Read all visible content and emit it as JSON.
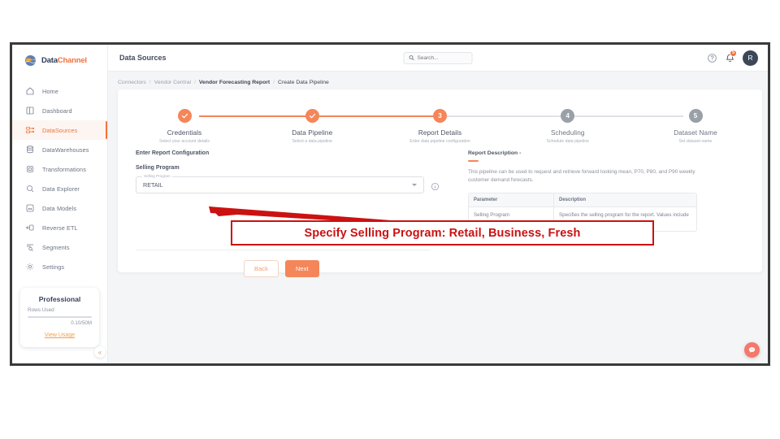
{
  "brand": {
    "part1": "Data",
    "part2": "Channel",
    "logo_icon": "globe-logo-icon"
  },
  "sidebar": {
    "items": [
      {
        "label": "Home",
        "icon": "home-icon",
        "active": false
      },
      {
        "label": "Dashboard",
        "icon": "dashboard-icon",
        "active": false
      },
      {
        "label": "DataSources",
        "icon": "datasources-icon",
        "active": true
      },
      {
        "label": "DataWarehouses",
        "icon": "database-icon",
        "active": false
      },
      {
        "label": "Transformations",
        "icon": "transformations-icon",
        "active": false
      },
      {
        "label": "Data Explorer",
        "icon": "explorer-icon",
        "active": false
      },
      {
        "label": "Data Models",
        "icon": "models-icon",
        "active": false
      },
      {
        "label": "Reverse ETL",
        "icon": "reverse-etl-icon",
        "active": false
      },
      {
        "label": "Segments",
        "icon": "segments-icon",
        "active": false
      },
      {
        "label": "Settings",
        "icon": "gear-icon",
        "active": false
      }
    ],
    "plan": {
      "tier": "Professional",
      "rows_label": "Rows Used",
      "usage": "0.10/50M",
      "view_usage": "View Usage",
      "progress_pct": 1
    },
    "collapse_glyph": "«"
  },
  "header": {
    "title": "Data Sources",
    "search": {
      "placeholder": "Search...",
      "value": ""
    },
    "help_icon": "help-circle-icon",
    "bell_icon": "bell-icon",
    "bell_badge": "5",
    "avatar_initial": "R"
  },
  "breadcrumb": [
    {
      "label": "Connectors",
      "style": "muted"
    },
    {
      "label": "Vendor Central",
      "style": "muted"
    },
    {
      "label": "Vendor Forecasting Report",
      "style": "strong"
    },
    {
      "label": "Create Data Pipeline",
      "style": "last"
    }
  ],
  "stepper": {
    "steps": [
      {
        "num": "1",
        "title": "Credentials",
        "sub": "Select your account details",
        "state": "done"
      },
      {
        "num": "2",
        "title": "Data Pipeline",
        "sub": "Select a data pipeline",
        "state": "done"
      },
      {
        "num": "3",
        "title": "Report Details",
        "sub": "Enter data pipeline configuration",
        "state": "active"
      },
      {
        "num": "4",
        "title": "Scheduling",
        "sub": "Schedule data pipeline",
        "state": "todo"
      },
      {
        "num": "5",
        "title": "Dataset Name",
        "sub": "Set dataset name",
        "state": "todo"
      }
    ]
  },
  "form": {
    "section_title": "Enter Report Configuration",
    "field_label": "Selling Program",
    "select": {
      "floating_label": "Selling Program",
      "value": "RETAIL",
      "options": [
        "RETAIL",
        "BUSINESS",
        "FRESH"
      ],
      "caret_icon": "chevron-down-icon",
      "info_icon": "info-circle-icon"
    },
    "back_label": "Back",
    "next_label": "Next"
  },
  "description": {
    "title": "Report Description -",
    "text": "This pipeline can be used to request and retrieve forward looking mean, P70, P80, and P90 weekly customer demand forecasts.",
    "table": {
      "headers": [
        "Parameter",
        "Description"
      ],
      "rows": [
        [
          "Selling Program",
          "Specifies the selling program for the report. Values include RETAIL and FRESH."
        ]
      ]
    }
  },
  "annotation": {
    "text": "Specify Selling Program: Retail, Business, Fresh",
    "color": "#cc1111"
  },
  "chat": {
    "icon": "chat-bubble-icon"
  }
}
